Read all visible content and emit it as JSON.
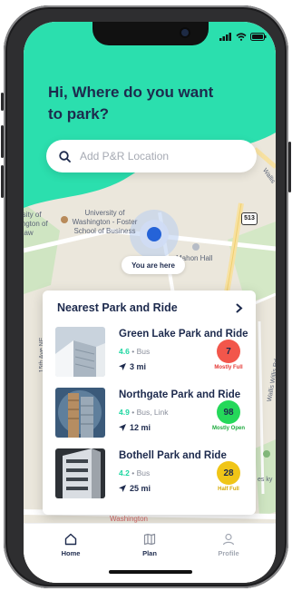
{
  "greeting": "Hi, Where do you want to park?",
  "search": {
    "placeholder": "Add P&R Location",
    "icon": "search-icon"
  },
  "map": {
    "labels": {
      "university": "University of Washington - Foster School of Business",
      "univ_law": "rsity of ington of Law",
      "mahon": "Mahon Hall",
      "route": "513",
      "avenue": "15th Ave NE",
      "washington": "Washington",
      "wallis": "Wallis",
      "wallis_willis": "Wallis Willis Rd",
      "es_ky": "es ky"
    },
    "you_are_here": "You are here"
  },
  "card": {
    "title": "Nearest Park and Ride",
    "items": [
      {
        "name": "Green Lake Park and Ride",
        "rating": "4.6",
        "sep": "•",
        "modes": "Bus",
        "distance": "3 mi",
        "spots": "7",
        "status": "Mostly Full",
        "badge_color": "#f2564b",
        "status_color": "#e53935"
      },
      {
        "name": "Northgate Park and Ride",
        "rating": "4.9",
        "sep": "•",
        "modes": "Bus, Link",
        "distance": "12 mi",
        "spots": "98",
        "status": "Mostly Open",
        "badge_color": "#25d85a",
        "status_color": "#1faa3f"
      },
      {
        "name": "Bothell Park and Ride",
        "rating": "4.2",
        "sep": "•",
        "modes": "Bus",
        "distance": "25 mi",
        "spots": "28",
        "status": "Half Full",
        "badge_color": "#f0c517",
        "status_color": "#d4a800"
      }
    ]
  },
  "tabs": [
    {
      "label": "Home",
      "icon": "home-icon",
      "active": true
    },
    {
      "label": "Plan",
      "icon": "map-book-icon",
      "active": false
    },
    {
      "label": "Profile",
      "icon": "user-icon",
      "active": false
    }
  ],
  "colors": {
    "accent": "#2bdfae",
    "primary_text": "#1d2a4d",
    "location_dot": "#2563d8"
  }
}
